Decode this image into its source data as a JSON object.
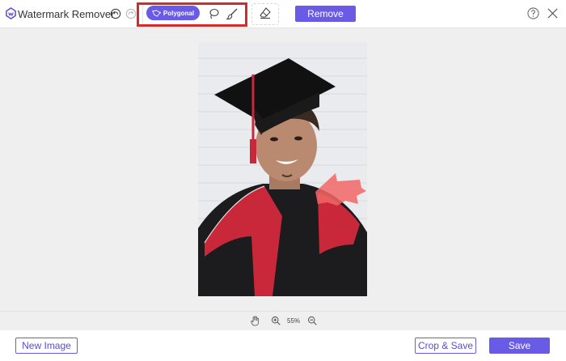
{
  "app": {
    "title": "Watermark Remover"
  },
  "toolbar": {
    "undo_icon": "undo-icon",
    "redo_icon": "redo-icon",
    "tools": [
      {
        "label": "Polygonal",
        "icon": "polygonal-icon",
        "active": true
      },
      {
        "label": "",
        "icon": "lasso-icon",
        "active": false
      },
      {
        "label": "",
        "icon": "brush-icon",
        "active": false
      }
    ],
    "eraser_icon": "eraser-icon",
    "remove_label": "Remove",
    "help_icon": "help-icon",
    "close_icon": "close-icon"
  },
  "canvas": {
    "image_description": "graduation-portrait-photo",
    "selection_color": "#f26666"
  },
  "zoom": {
    "level": "55%",
    "hand_icon": "hand-icon",
    "zoom_in_icon": "zoom-in-icon",
    "zoom_out_icon": "zoom-out-icon"
  },
  "footer": {
    "new_image_label": "New Image",
    "crop_save_label": "Crop & Save",
    "save_label": "Save"
  },
  "colors": {
    "accent": "#6a5be6",
    "highlight": "#d42a2a"
  }
}
